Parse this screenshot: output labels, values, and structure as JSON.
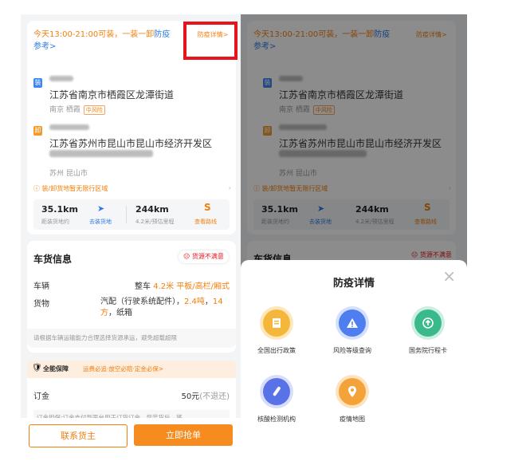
{
  "screen": {
    "notice_text": "今天13:00-21:00可装，一装一卸",
    "notice_link": "防疫参考>",
    "notice_button": "防疫详情>",
    "load": {
      "pin": "装",
      "address": "江苏省南京市栖霞区龙潭街道",
      "district": "南京 栖霞",
      "risk_tag": "中风险"
    },
    "unload": {
      "pin": "卸",
      "address": "江苏省苏州市昆山市昆山市经济开发区",
      "district": "苏州 昆山市"
    },
    "restriction_note": "装/卸货地暂无限行区域",
    "distance_to_load": "35.1km",
    "distance_to_load_label": "距装货地约",
    "navigate_label": "去装货地",
    "route_distance": "244km",
    "route_distance_label": "4.2米/预估里程",
    "route_label": "查看路线",
    "cargo_section_title": "车货信息",
    "dissatisfied_label": "货源不满意",
    "vehicle_label": "车辆",
    "vehicle_value_prefix": "整车",
    "vehicle_value_highlight": "4.2米 平板/高栏/厢式",
    "goods_label": "货物",
    "goods_value": "汽配（行驶系统配件），",
    "goods_weight": "2.4吨",
    "goods_count": "14方",
    "goods_pack": "纸箱",
    "capacity_note": "请根据车辆运输能力合理选择货源承运，避免超载超限",
    "guarantee_badge": "全能保障",
    "guarantee_text": "运费必追·放空必赔·定金必保>",
    "deposit_label": "订金",
    "deposit_value": "50元",
    "deposit_refund": "(不退还)",
    "deposit_note": "订金担保:订金支付到平台用于订货订金，您装货后，将",
    "contact_button": "联系货主",
    "grab_button": "立即抢单"
  },
  "sheet": {
    "title": "防疫详情",
    "close_glyph": "×",
    "items": [
      {
        "label": "全国出行政策",
        "color": "#f4b73b",
        "icon": "policy-icon"
      },
      {
        "label": "风险等级查询",
        "color": "#4f7ef0",
        "icon": "warning-icon"
      },
      {
        "label": "国务院行程卡",
        "color": "#3ab98b",
        "icon": "trip-card-icon"
      },
      {
        "label": "核酸检测机构",
        "color": "#5a72e8",
        "icon": "test-tube-icon"
      },
      {
        "label": "疫情地图",
        "color": "#f4a338",
        "icon": "map-pin-icon"
      }
    ]
  },
  "highlight_color": "#e8141b"
}
